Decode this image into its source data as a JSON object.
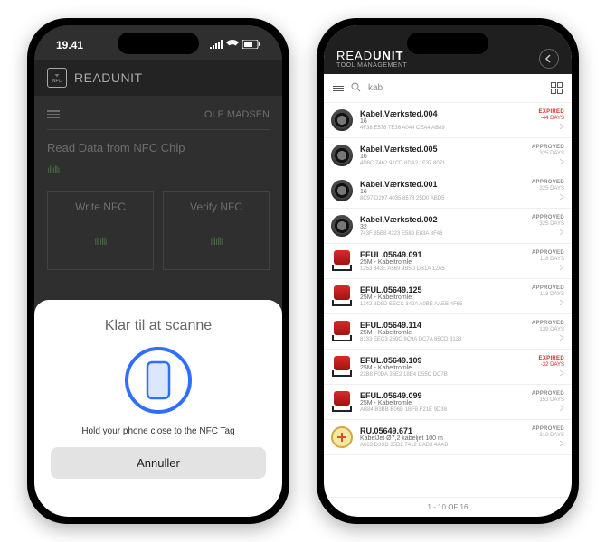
{
  "left": {
    "status_time": "19.41",
    "app_title": "READUNIT",
    "user_name": "OLE MADSEN",
    "page_title": "Read Data from NFC Chip",
    "write_label": "Write NFC",
    "verify_label": "Verify NFC",
    "sheet": {
      "title": "Klar til at scanne",
      "subtitle": "Hold your phone close to the NFC Tag",
      "cancel": "Annuller"
    }
  },
  "right": {
    "app_title_a": "READ",
    "app_title_b": "UNIT",
    "app_subtitle": "TOOL MANAGEMENT",
    "search_value": "kab",
    "footer": "1 - 10 OF 16",
    "items": [
      {
        "icon": "coil",
        "title": "Kabel.Værksted.004",
        "sub": "16",
        "uid": "4F38 E578 7E36 A044 CEA4 AB89",
        "status": "EXPIRED",
        "days": "-44 DAYS",
        "bad": true
      },
      {
        "icon": "coil",
        "title": "Kabel.Værksted.005",
        "sub": "16",
        "uid": "4D8C 7462 91CD 8DA2 1F37 8071",
        "status": "APPROVED",
        "days": "325 DAYS",
        "bad": false
      },
      {
        "icon": "coil",
        "title": "Kabel.Værksted.001",
        "sub": "16",
        "uid": "8C97 D297 4035 8578 25D0 ABD5",
        "status": "APPROVED",
        "days": "325 DAYS",
        "bad": false
      },
      {
        "icon": "coil",
        "title": "Kabel.Værksted.002",
        "sub": "32",
        "uid": "743F 35B8 4223 E589 E83A 8F46",
        "status": "APPROVED",
        "days": "325 DAYS",
        "bad": false
      },
      {
        "icon": "reel",
        "title": "EFUL.05649.091",
        "sub": "25M - Kabeltromle",
        "uid": "1253 843E A569 9B5D DB1A 12A5",
        "status": "APPROVED",
        "days": "118 DAYS",
        "bad": false
      },
      {
        "icon": "reel",
        "title": "EFUL.05649.125",
        "sub": "25M - Kabeltromle",
        "uid": "1342 3D9D EECC 342A A0BE AAEB 4F65",
        "status": "APPROVED",
        "days": "118 DAYS",
        "bad": false
      },
      {
        "icon": "reel",
        "title": "EFUL.05649.114",
        "sub": "25M - Kabeltromle",
        "uid": "8133 EEC3 250C 9C9A DC7A 85CD 3133",
        "status": "APPROVED",
        "days": "139 DAYS",
        "bad": false
      },
      {
        "icon": "reel",
        "title": "EFUL.05649.109",
        "sub": "25M - Kabeltromle",
        "uid": "22B8 F0DA 35E2 18E4 D55C DC7B",
        "status": "EXPIRED",
        "days": "-32 DAYS",
        "bad": true
      },
      {
        "icon": "reel",
        "title": "EFUL.05649.099",
        "sub": "25M - Kabeltromle",
        "uid": "AB84 B3BB B06B 1BF8 F21E 9D38",
        "status": "APPROVED",
        "days": "153 DAYS",
        "bad": false
      },
      {
        "icon": "tape",
        "title": "RU.05649.671",
        "sub": "KabelJet Ø7,2 kabeljet 100 m",
        "uid": "A663 D3SD 35D2 7412 CAD3 4AAB",
        "status": "APPROVED",
        "days": "310 DAYS",
        "bad": false
      }
    ]
  }
}
